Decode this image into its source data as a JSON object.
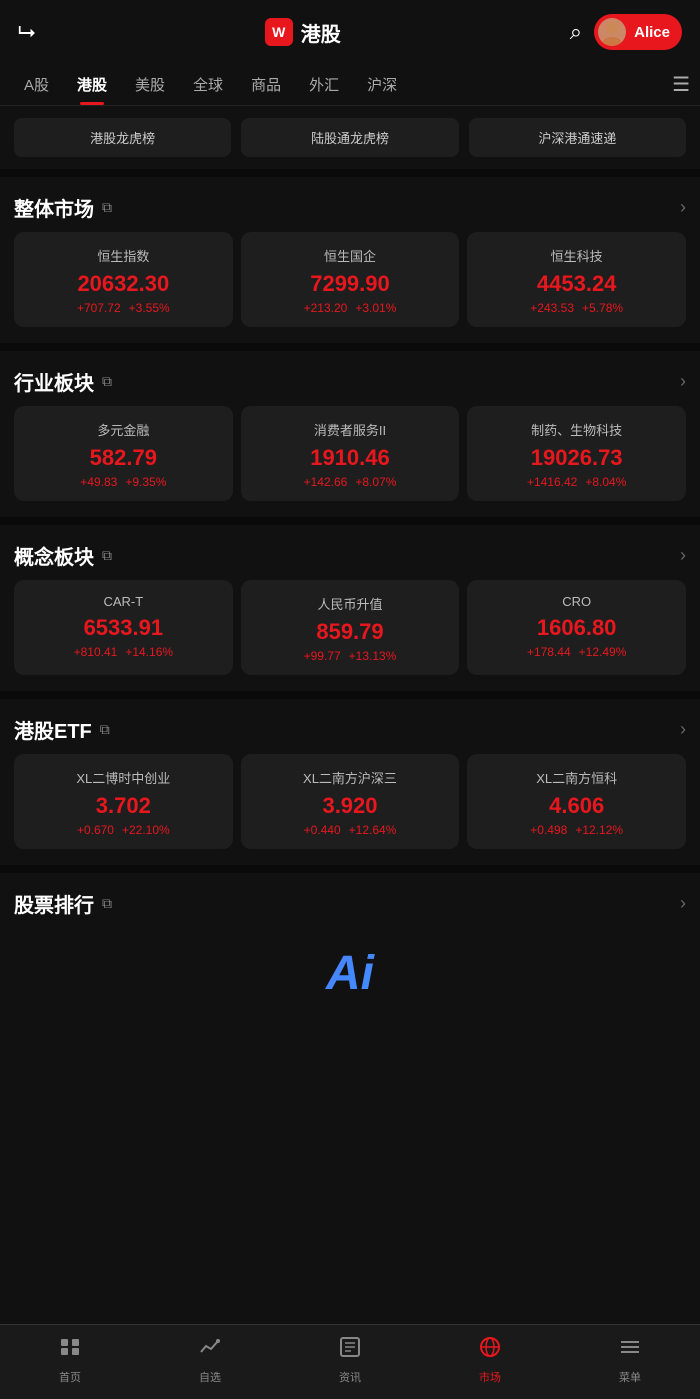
{
  "header": {
    "logo_text": "W",
    "title": "港股",
    "user_name": "Alice"
  },
  "nav_tabs": {
    "items": [
      {
        "label": "A股",
        "active": false
      },
      {
        "label": "港股",
        "active": true
      },
      {
        "label": "美股",
        "active": false
      },
      {
        "label": "全球",
        "active": false
      },
      {
        "label": "商品",
        "active": false
      },
      {
        "label": "外汇",
        "active": false
      },
      {
        "label": "沪深",
        "active": false
      }
    ]
  },
  "quick_links": [
    {
      "label": "港股龙虎榜"
    },
    {
      "label": "陆股通龙虎榜"
    },
    {
      "label": "沪深港通速递"
    }
  ],
  "sections": {
    "market": {
      "title": "整体市场",
      "cards": [
        {
          "name": "恒生指数",
          "value": "20632.30",
          "change1": "+707.72",
          "change2": "+3.55%"
        },
        {
          "name": "恒生国企",
          "value": "7299.90",
          "change1": "+213.20",
          "change2": "+3.01%"
        },
        {
          "name": "恒生科技",
          "value": "4453.24",
          "change1": "+243.53",
          "change2": "+5.78%"
        }
      ]
    },
    "industry": {
      "title": "行业板块",
      "cards": [
        {
          "name": "多元金融",
          "value": "582.79",
          "change1": "+49.83",
          "change2": "+9.35%"
        },
        {
          "name": "消费者服务II",
          "value": "1910.46",
          "change1": "+142.66",
          "change2": "+8.07%"
        },
        {
          "name": "制药、生物科技",
          "value": "19026.73",
          "change1": "+1416.42",
          "change2": "+8.04%"
        }
      ]
    },
    "concept": {
      "title": "概念板块",
      "cards": [
        {
          "name": "CAR-T",
          "value": "6533.91",
          "change1": "+810.41",
          "change2": "+14.16%"
        },
        {
          "name": "人民币升值",
          "value": "859.79",
          "change1": "+99.77",
          "change2": "+13.13%"
        },
        {
          "name": "CRO",
          "value": "1606.80",
          "change1": "+178.44",
          "change2": "+12.49%"
        }
      ]
    },
    "etf": {
      "title": "港股ETF",
      "cards": [
        {
          "name": "XL二博时中创业",
          "value": "3.702",
          "change1": "+0.670",
          "change2": "+22.10%"
        },
        {
          "name": "XL二南方沪深三",
          "value": "3.920",
          "change1": "+0.440",
          "change2": "+12.64%"
        },
        {
          "name": "XL二南方恒科",
          "value": "4.606",
          "change1": "+0.498",
          "change2": "+12.12%"
        }
      ]
    },
    "ranking": {
      "title": "股票排行"
    }
  },
  "bottom_nav": [
    {
      "label": "首页",
      "icon": "📅",
      "active": false
    },
    {
      "label": "自选",
      "icon": "📈",
      "active": false
    },
    {
      "label": "资讯",
      "icon": "📄",
      "active": false
    },
    {
      "label": "市场",
      "icon": "🌐",
      "active": true
    },
    {
      "label": "菜单",
      "icon": "☰",
      "active": false
    }
  ],
  "ai_text": "Ai"
}
